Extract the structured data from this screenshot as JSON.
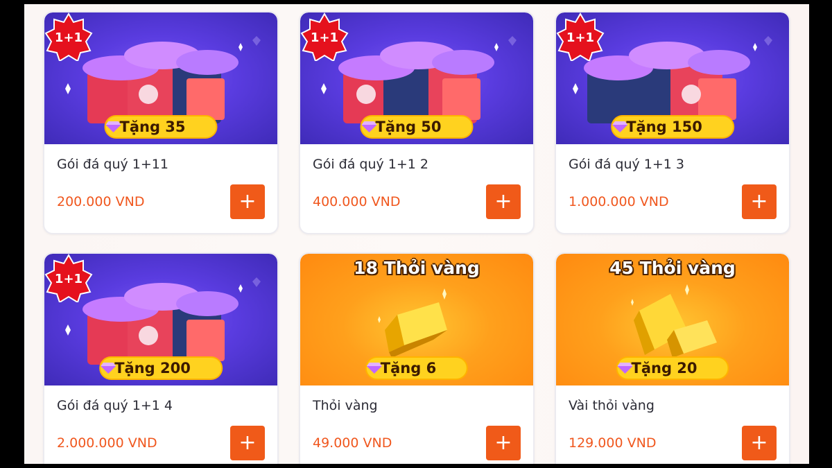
{
  "colors": {
    "accent": "#f05a19",
    "price": "#f0571e",
    "gift_pill": "#ffd21f"
  },
  "products": [
    {
      "name": "Gói đá quý 1+11",
      "price": "200.000 VND",
      "gift": "Tặng 35",
      "banner_title": "",
      "badge": "1+1",
      "add_label": "+"
    },
    {
      "name": "Gói đá quý 1+1 2",
      "price": "400.000 VND",
      "gift": "Tặng 50",
      "banner_title": "",
      "badge": "1+1",
      "add_label": "+"
    },
    {
      "name": "Gói đá quý 1+1 3",
      "price": "1.000.000 VND",
      "gift": "Tặng 150",
      "banner_title": "",
      "badge": "1+1",
      "add_label": "+"
    },
    {
      "name": "Gói đá quý 1+1 4",
      "price": "2.000.000 VND",
      "gift": "Tặng 200",
      "banner_title": "",
      "badge": "1+1",
      "add_label": "+"
    },
    {
      "name": "Thỏi vàng",
      "price": "49.000 VND",
      "gift": "Tặng 6",
      "banner_title": "18 Thỏi vàng",
      "badge": "",
      "add_label": "+"
    },
    {
      "name": "Vài thỏi vàng",
      "price": "129.000 VND",
      "gift": "Tặng 20",
      "banner_title": "45 Thỏi vàng",
      "badge": "",
      "add_label": "+"
    }
  ],
  "icons": {
    "gem": "gem-icon",
    "chest": "treasure-chest-icon",
    "gold_bar": "gold-bar-icon",
    "badge": "one-plus-one-badge-icon",
    "add": "plus-icon"
  }
}
